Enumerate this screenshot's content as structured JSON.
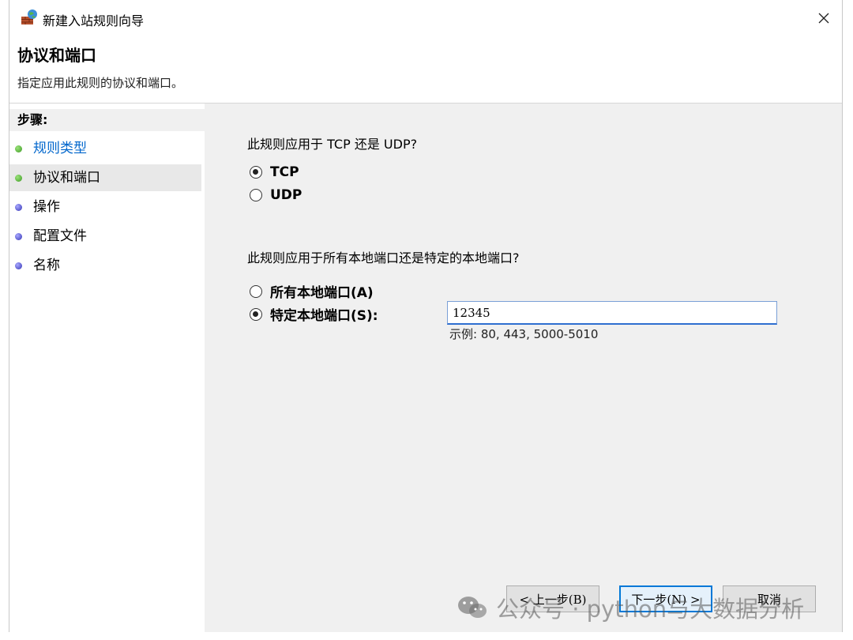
{
  "window": {
    "title": "新建入站规则向导",
    "close_glyph": "✕"
  },
  "header": {
    "title": "协议和端口",
    "subtitle": "指定应用此规则的协议和端口。"
  },
  "sidebar": {
    "heading": "步骤:",
    "steps": [
      {
        "label": "规则类型",
        "state": "done"
      },
      {
        "label": "协议和端口",
        "state": "current"
      },
      {
        "label": "操作",
        "state": "todo"
      },
      {
        "label": "配置文件",
        "state": "todo"
      },
      {
        "label": "名称",
        "state": "todo"
      }
    ]
  },
  "protocol": {
    "question": "此规则应用于 TCP 还是 UDP?",
    "options": [
      {
        "label": "TCP",
        "checked": true
      },
      {
        "label": "UDP",
        "checked": false
      }
    ]
  },
  "ports": {
    "question": "此规则应用于所有本地端口还是特定的本地端口?",
    "options": [
      {
        "label": "所有本地端口(A)",
        "checked": false
      },
      {
        "label": "特定本地端口(S):",
        "checked": true
      }
    ],
    "value": "12345",
    "example": "示例: 80, 443, 5000-5010"
  },
  "buttons": {
    "back": "< 上一步(B)",
    "next": "下一步(N) >",
    "cancel": "取消"
  },
  "watermark": {
    "text": "公众号 · python与大数据分析",
    "icon": "wechat-icon"
  },
  "colors": {
    "link": "#0066cc",
    "step_done": "#3d9a25",
    "step_todo": "#3434b5",
    "accent": "#0078d7"
  }
}
